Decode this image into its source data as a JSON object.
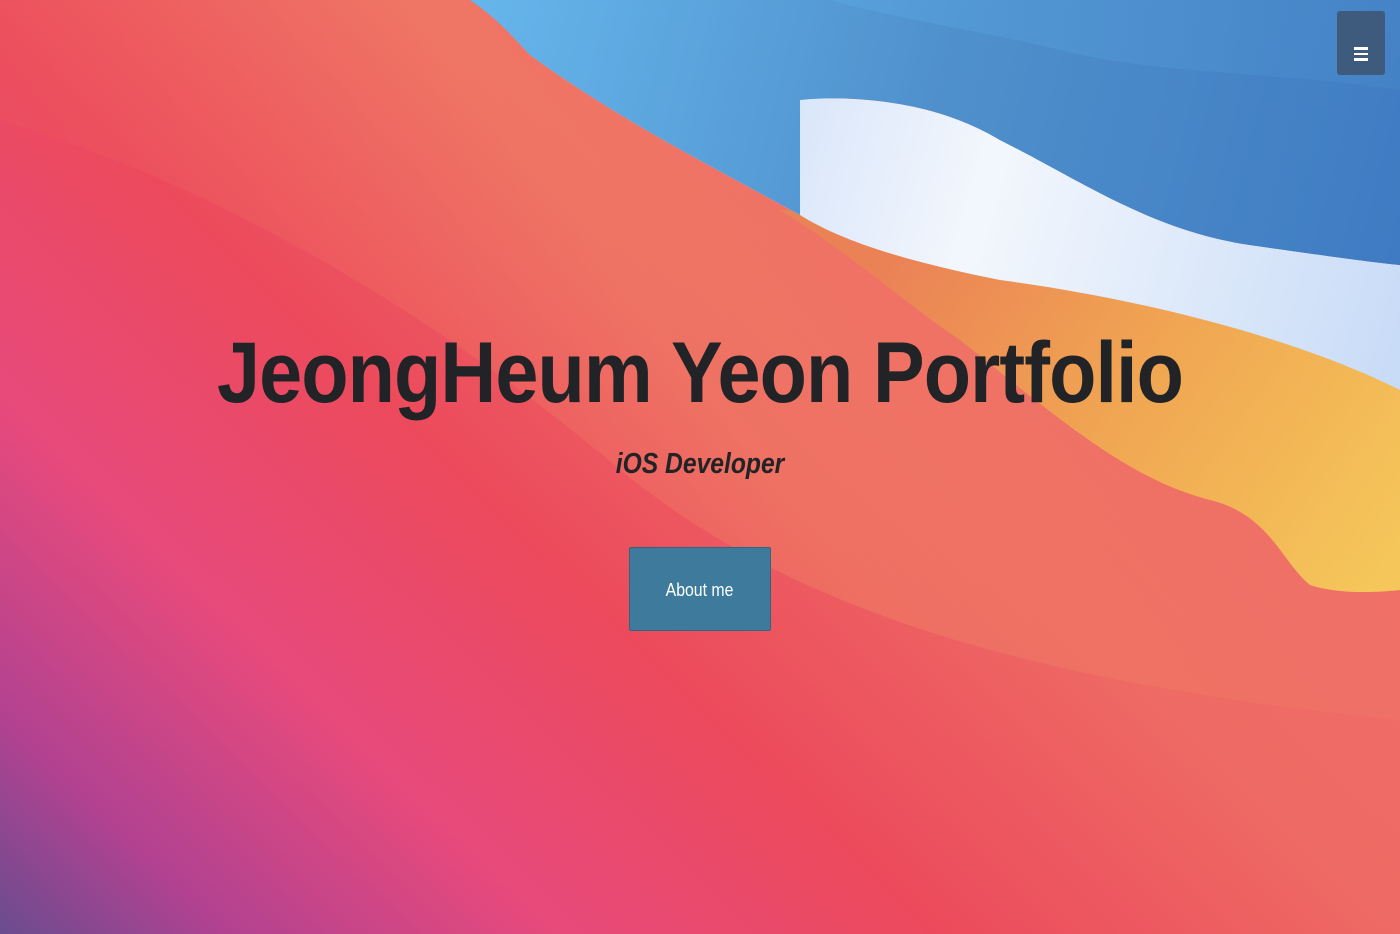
{
  "hero": {
    "title": "JeongHeum Yeon Portfolio",
    "subtitle": "iOS Developer",
    "cta_label": "About me"
  },
  "nav": {
    "menu_icon": "hamburger-menu-icon"
  },
  "colors": {
    "title_text": "#222326",
    "cta_background": "#3d7a9c",
    "cta_text": "#ffffff",
    "menu_button_background": "#3e5a7d",
    "background_blue": "#4a8bc9",
    "background_red": "#ec4a5c",
    "background_orange": "#f0a154",
    "background_purple": "#6e4c8e"
  }
}
